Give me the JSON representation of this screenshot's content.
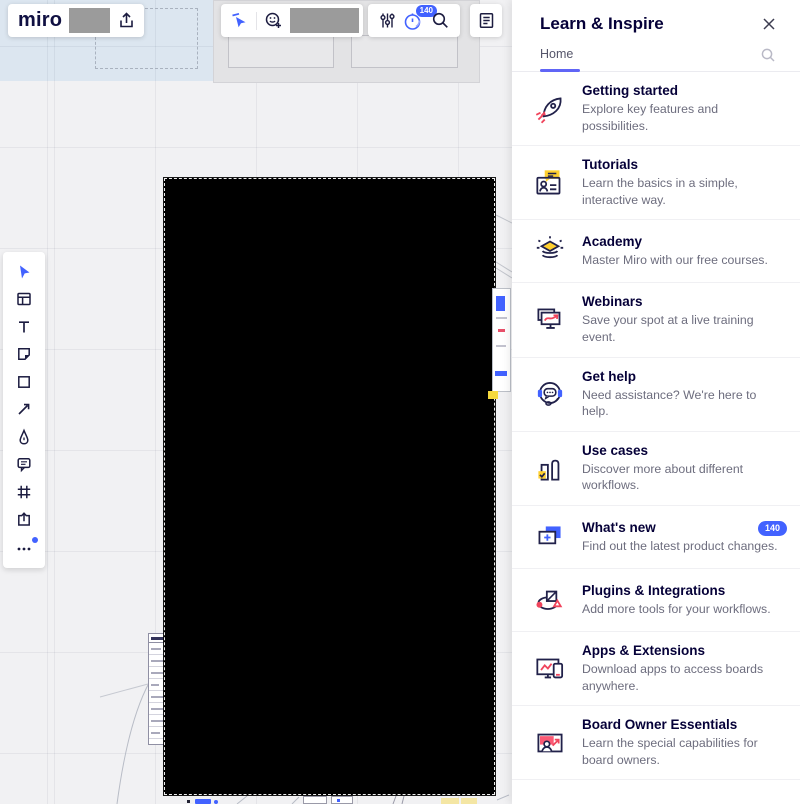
{
  "brand": {
    "logo_text": "miro"
  },
  "top_toolbar": {
    "follow_badge": "140"
  },
  "left_toolbar": {
    "tools": [
      "select",
      "templates",
      "text",
      "sticky-note",
      "shapes",
      "connection-line",
      "pen",
      "comment",
      "frame",
      "upload",
      "more"
    ]
  },
  "panel": {
    "title": "Learn & Inspire",
    "tabs": [
      {
        "label": "Home"
      }
    ],
    "items": [
      {
        "icon": "rocket-icon",
        "title": "Getting started",
        "desc": "Explore key features and possibilities."
      },
      {
        "icon": "tutorials-icon",
        "title": "Tutorials",
        "desc": "Learn the basics in a simple, interactive way."
      },
      {
        "icon": "academy-icon",
        "title": "Academy",
        "desc": "Master Miro with our free courses."
      },
      {
        "icon": "webinars-icon",
        "title": "Webinars",
        "desc": "Save your spot at a live training event."
      },
      {
        "icon": "get-help-icon",
        "title": "Get help",
        "desc": "Need assistance? We're here to help."
      },
      {
        "icon": "use-cases-icon",
        "title": "Use cases",
        "desc": "Discover more about different workflows."
      },
      {
        "icon": "whats-new-icon",
        "title": "What's new",
        "desc": "Find out the latest product changes.",
        "badge": "140"
      },
      {
        "icon": "plugins-icon",
        "title": "Plugins & Integrations",
        "desc": "Add more tools for your workflows."
      },
      {
        "icon": "apps-extensions-icon",
        "title": "Apps & Extensions",
        "desc": "Download apps to access boards anywhere."
      },
      {
        "icon": "board-owner-icon",
        "title": "Board Owner Essentials",
        "desc": "Learn the special capabilities for board owners."
      }
    ]
  },
  "colors": {
    "accent_blue": "#4262ff",
    "underline_blue": "#6065f6",
    "navy": "#050038",
    "yellow": "#ffd02f",
    "red": "#f0445c"
  }
}
